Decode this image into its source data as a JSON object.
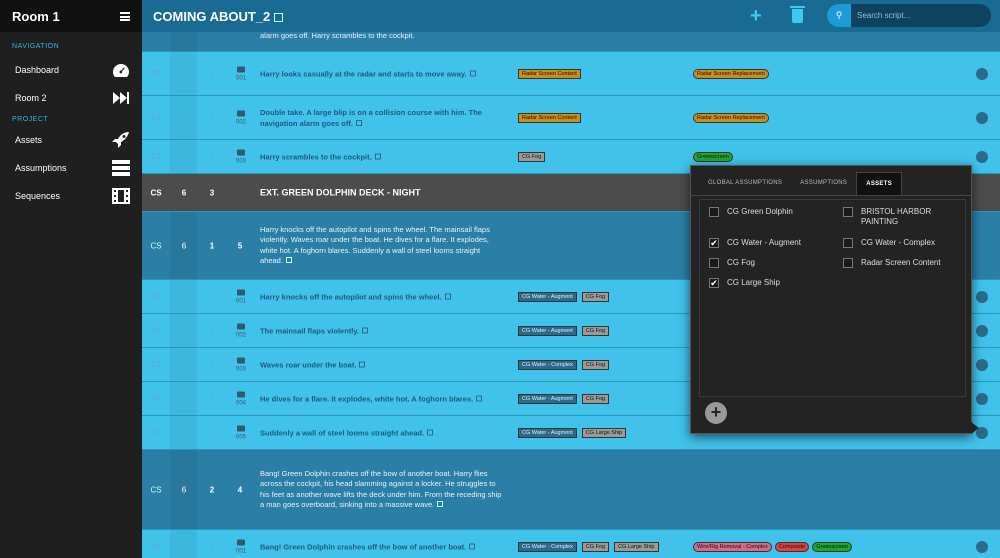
{
  "sidebar": {
    "room": "Room 1",
    "nav_title": "NAVIGATION",
    "items_nav": [
      {
        "label": "Dashboard",
        "icon": "speedometer-icon"
      },
      {
        "label": "Room 2",
        "icon": "fast-forward-icon"
      }
    ],
    "project_title": "PROJECT",
    "items_proj": [
      {
        "label": "Assets",
        "icon": "rocket-icon"
      },
      {
        "label": "Assumptions",
        "icon": "server-icon"
      },
      {
        "label": "Sequences",
        "icon": "film-icon"
      }
    ]
  },
  "header": {
    "title": "COMING ABOUT_2",
    "search_placeholder": "Search script..."
  },
  "rows": [
    {
      "kind": "para_partial",
      "text": "alarm goes off. Harry scrambles to the cockpit."
    },
    {
      "kind": "shot",
      "cs": "CS",
      "a": "5",
      "b": "1",
      "num": "001",
      "text": "Harry looks casually at the radar and starts to move away.",
      "tags": [
        "Radar Screen Content"
      ],
      "tags2": [
        {
          "label": "Radar Screen Replacement",
          "color": "#c8901b"
        }
      ]
    },
    {
      "kind": "shot",
      "cs": "CS",
      "a": "5",
      "b": "1",
      "num": "002",
      "text": "Double take. A large blip is on a collision course with him. The navigation alarm goes off.",
      "tags": [
        "Radar Screen Content"
      ],
      "tags2": [
        {
          "label": "Radar Screen Replacement",
          "color": "#c8901b"
        }
      ]
    },
    {
      "kind": "shot",
      "cs": "CS",
      "a": "5",
      "b": "1",
      "num": "003",
      "text": "Harry scrambles to the cockpit.",
      "tags": [
        "CG Fog"
      ],
      "tags2": [
        {
          "label": "Greenscreen",
          "color": "#1fa631"
        }
      ]
    },
    {
      "kind": "head",
      "cs": "CS",
      "a": "6",
      "b": "3",
      "text": "EXT. GREEN DOLPHIN DECK - NIGHT"
    },
    {
      "kind": "para",
      "cs": "CS",
      "a": "6",
      "b": "1",
      "c": "5",
      "text": "Harry knocks off the autopilot and spins the wheel. The mainsail flaps violently. Waves roar under the boat. He dives for a flare. It explodes, white hot. A foghorn blares. Suddenly a wall of steel looms straight ahead."
    },
    {
      "kind": "shot",
      "cs": "CS",
      "a": "6",
      "b": "1",
      "num": "001",
      "text": "Harry knocks off the autopilot and spins the wheel.",
      "tags": [
        "CG Water - Augment",
        "CG Fog"
      ],
      "tags2": []
    },
    {
      "kind": "shot",
      "cs": "CS",
      "a": "6",
      "b": "1",
      "num": "002",
      "text": "The mainsail flaps violently.",
      "tags": [
        "CG Water - Augment",
        "CG Fog"
      ],
      "tags2": []
    },
    {
      "kind": "shot",
      "cs": "CS",
      "a": "6",
      "b": "1",
      "num": "003",
      "text": "Waves roar under the boat.",
      "tags": [
        "CG Water - Complex",
        "CG Fog"
      ],
      "tags2": []
    },
    {
      "kind": "shot",
      "cs": "CS",
      "a": "6",
      "b": "1",
      "num": "004",
      "text": "He dives for a flare. It explodes, white hot. A foghorn blares.",
      "tags": [
        "CG Water - Augment",
        "CG Fog"
      ],
      "tags2": []
    },
    {
      "kind": "shot",
      "cs": "CS",
      "a": "6",
      "b": "1",
      "num": "005",
      "text": "Suddenly a wall of steel looms straight ahead.",
      "tags": [
        "CG Water - Augment",
        "CG Large Ship"
      ],
      "tags2": []
    },
    {
      "kind": "para",
      "cs": "CS",
      "a": "6",
      "b": "2",
      "c": "4",
      "text": "Bang! Green Dolphin crashes off the bow of another boat. Harry flies across the cockpit, his head slamming against a locker. He struggles to his feet as another wave lifts the deck under him. From the receding ship a man goes overboard, sinking into a massive wave."
    },
    {
      "kind": "shot",
      "cs": "CS",
      "a": "6",
      "b": "2",
      "num": "001",
      "text": "Bang! Green Dolphin crashes off the bow of another boat.",
      "tags": [
        "CG Water - Complex",
        "CG Fog",
        "CG Large Ship"
      ],
      "tags2": [
        {
          "label": "Wire/Rig Removal - Complex",
          "color": "#d46a8e"
        },
        {
          "label": "Composite",
          "color": "#e04040"
        },
        {
          "label": "Greenscreen",
          "color": "#1fa631"
        }
      ]
    }
  ],
  "popup": {
    "tabs": [
      "GLOBAL ASSUMPTIONS",
      "ASSUMPTIONS",
      "ASSETS"
    ],
    "active_tab": "ASSETS",
    "assets": [
      {
        "label": "CG Green Dolphin",
        "checked": false
      },
      {
        "label": "BRISTOL HARBOR PAINTING",
        "checked": false
      },
      {
        "label": "CG Water - Augment",
        "checked": true
      },
      {
        "label": "CG Water - Complex",
        "checked": false
      },
      {
        "label": "CG Fog",
        "checked": false
      },
      {
        "label": "Radar Screen Content",
        "checked": false
      },
      {
        "label": "CG Large Ship",
        "checked": true
      }
    ]
  },
  "colors": {
    "sidebar": "#1f1f1f",
    "topbar": "#1a6b93",
    "row": "#40c2eb",
    "scene": "#2b7fa7",
    "accent": "#3fb0e0"
  }
}
